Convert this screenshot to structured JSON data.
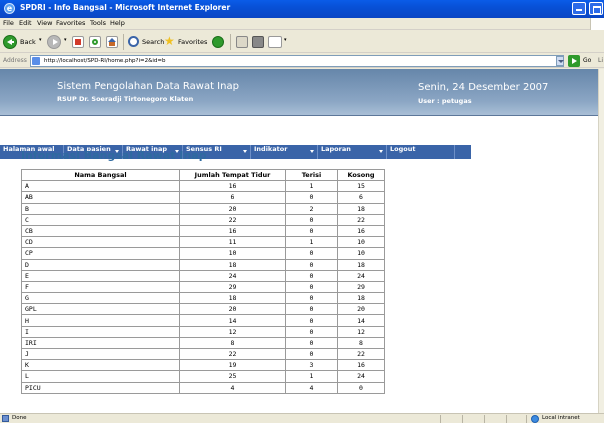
{
  "window": {
    "title": "SPDRI - Info Bangsal - Microsoft Internet Explorer"
  },
  "menu": [
    "File",
    "Edit",
    "View",
    "Favorites",
    "Tools",
    "Help"
  ],
  "toolbar": {
    "back_label": "Back",
    "search_label": "Search",
    "favorites_label": "Favorites"
  },
  "address": {
    "label": "Address",
    "url": "http://localhost/SPD-RI/home.php?i=2&id=b",
    "go_label": "Go",
    "links_label": "Li"
  },
  "banner": {
    "system_title": "Sistem Pengolahan Data Rawat Inap",
    "hospital": "RSUP Dr. Soeradji Tirtonegoro Klaten",
    "date": "Senin, 24 Desember 2007",
    "user": "User : petugas"
  },
  "nav": [
    {
      "label": "Halaman awal",
      "caret": false
    },
    {
      "label": "Data pasien",
      "caret": true
    },
    {
      "label": "Rawat inap",
      "caret": true
    },
    {
      "label": "Sensus RI",
      "caret": true
    },
    {
      "label": "Indikator",
      "caret": true
    },
    {
      "label": "Laporan",
      "caret": true
    },
    {
      "label": "Logout",
      "caret": false
    }
  ],
  "page": {
    "heading": "Informasi Bangsal Rawat Inap"
  },
  "table": {
    "headers": [
      "Nama Bangsal",
      "Jumlah Tempat Tidur",
      "Terisi",
      "Kosong"
    ],
    "rows": [
      [
        "A",
        "16",
        "1",
        "15"
      ],
      [
        "AB",
        "6",
        "0",
        "6"
      ],
      [
        "B",
        "20",
        "2",
        "18"
      ],
      [
        "C",
        "22",
        "0",
        "22"
      ],
      [
        "CB",
        "16",
        "0",
        "16"
      ],
      [
        "CD",
        "11",
        "1",
        "10"
      ],
      [
        "CP",
        "10",
        "0",
        "10"
      ],
      [
        "D",
        "18",
        "0",
        "18"
      ],
      [
        "E",
        "24",
        "0",
        "24"
      ],
      [
        "F",
        "29",
        "0",
        "29"
      ],
      [
        "G",
        "18",
        "0",
        "18"
      ],
      [
        "GPL",
        "20",
        "0",
        "20"
      ],
      [
        "H",
        "14",
        "0",
        "14"
      ],
      [
        "I",
        "12",
        "0",
        "12"
      ],
      [
        "IRI",
        "8",
        "0",
        "8"
      ],
      [
        "J",
        "22",
        "0",
        "22"
      ],
      [
        "K",
        "19",
        "3",
        "16"
      ],
      [
        "L",
        "25",
        "1",
        "24"
      ],
      [
        "PICU",
        "4",
        "4",
        "0"
      ]
    ]
  },
  "status": {
    "text": "Done",
    "zone": "Local intranet"
  },
  "colors": {
    "titlebar": "#0850d6",
    "banner": "#8ba6c4",
    "navbar": "#3a64a8",
    "heading": "#2f6aa0"
  }
}
